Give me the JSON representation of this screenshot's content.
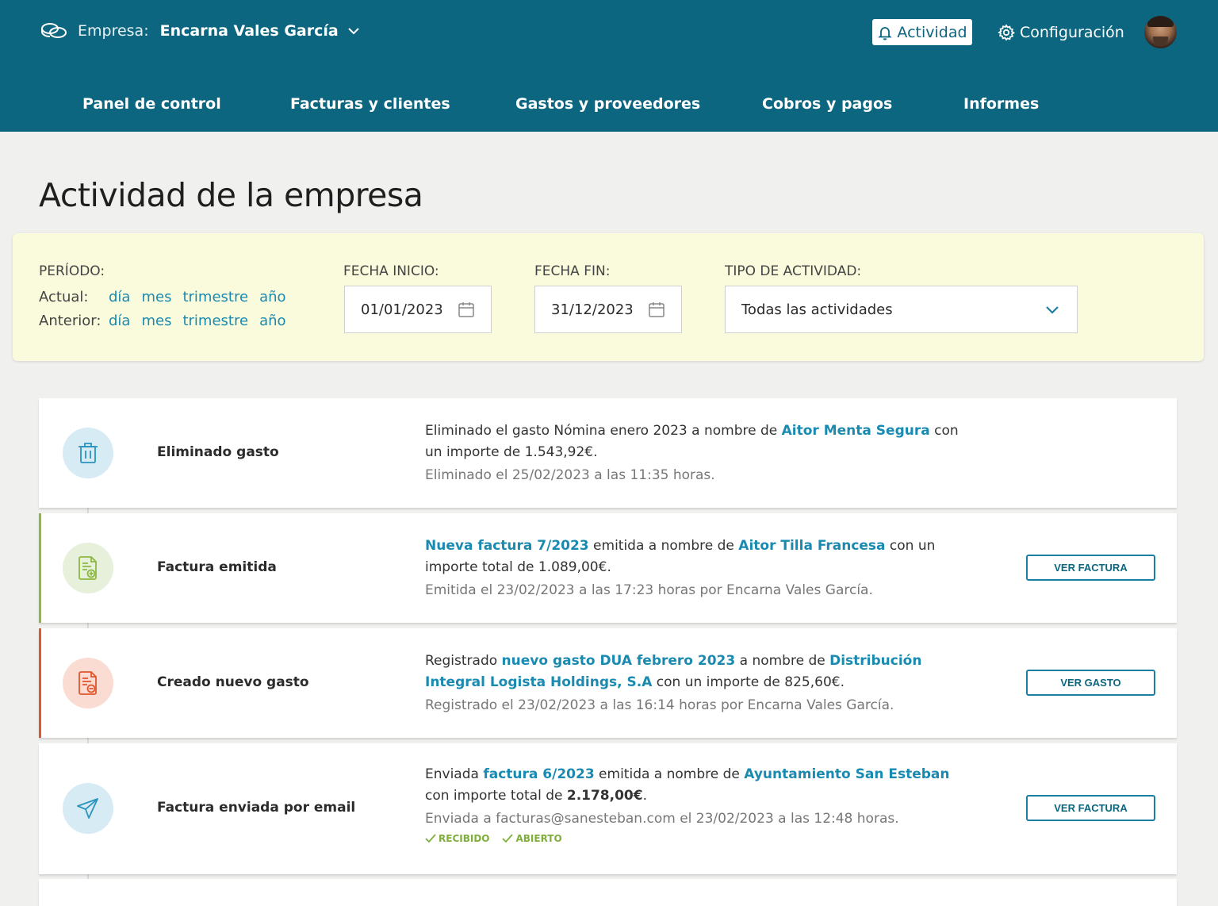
{
  "header": {
    "company_label": "Empresa:",
    "company_name": "Encarna Vales García",
    "activity_label": "Actividad",
    "config_label": "Configuración"
  },
  "nav": {
    "items": [
      "Panel de control",
      "Facturas y clientes",
      "Gastos y proveedores",
      "Cobros y pagos",
      "Informes"
    ]
  },
  "page": {
    "title": "Actividad de la empresa"
  },
  "filters": {
    "period_label": "PERÍODO:",
    "current_label": "Actual:",
    "previous_label": "Anterior:",
    "period_options": [
      "día",
      "mes",
      "trimestre",
      "año"
    ],
    "start_label": "FECHA INICIO:",
    "start_value": "01/01/2023",
    "end_label": "FECHA FIN:",
    "end_value": "31/12/2023",
    "type_label": "TIPO DE ACTIVIDAD:",
    "type_value": "Todas las actividades"
  },
  "activities": [
    {
      "type": "Eliminado gasto",
      "icon": "trash-icon",
      "t1": "Eliminado el gasto Nómina enero 2023 a nombre de ",
      "link1": "Aitor Menta Segura",
      "t2": " con un importe de 1.543,92€.",
      "meta": "Eliminado el 25/02/2023 a las 11:35 horas."
    },
    {
      "type": "Factura emitida",
      "icon": "invoice-add-icon",
      "link1": "Nueva factura 7/2023",
      "t1": " emitida a nombre de ",
      "link2": "Aitor Tilla Francesa",
      "t2": " con un importe total de 1.089,00€.",
      "meta": "Emitida el 23/02/2023 a las 17:23 horas por Encarna Vales García.",
      "button": "VER FACTURA"
    },
    {
      "type": "Creado nuevo gasto",
      "icon": "expense-doc-icon",
      "t0": "Registrado ",
      "link1": "nuevo gasto DUA febrero 2023",
      "t1": " a nombre de ",
      "link2": "Distribución Integral Logista Holdings, S.A",
      "t2": " con un importe de 825,60€.",
      "meta": "Registrado el 23/02/2023 a las 16:14 horas por Encarna Vales García.",
      "button": "VER GASTO"
    },
    {
      "type": "Factura enviada por email",
      "icon": "paper-plane-icon",
      "t0": "Enviada ",
      "link1": "factura 6/2023",
      "t1": " emitida a nombre de ",
      "link2": "Ayuntamiento San Esteban",
      "t2": " con importe total de ",
      "amount": "2.178,00€",
      "t3": ".",
      "meta": "Enviada a facturas@sanesteban.com el 23/02/2023 a las 12:48 horas.",
      "badges": [
        "RECIBIDO",
        "ABIERTO"
      ],
      "button": "VER FACTURA"
    }
  ],
  "colors": {
    "header_bg": "#0c6680",
    "link": "#1a8ab0",
    "filter_bg": "#fafadc",
    "accent_green": "#8cb843",
    "accent_red": "#e0562e"
  }
}
